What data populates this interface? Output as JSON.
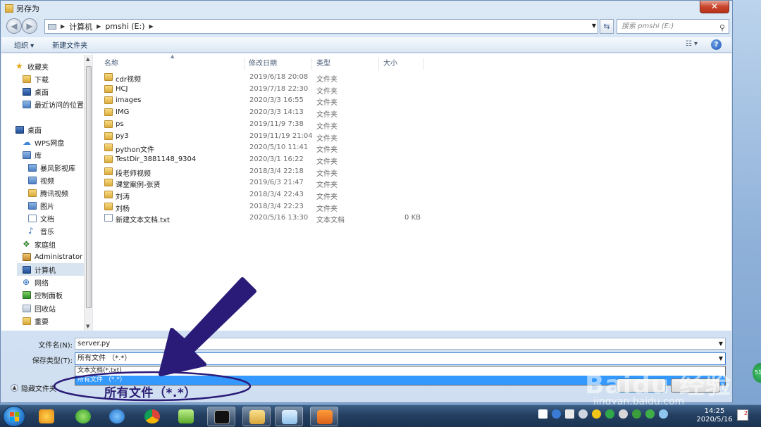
{
  "window": {
    "title": "另存为",
    "close_label": "✕"
  },
  "address": {
    "crumbs": [
      "计算机",
      "pmshi (E:)"
    ],
    "search_placeholder": "搜索 pmshi (E:)"
  },
  "toolbar": {
    "organize_label": "组织 ▾",
    "new_folder_label": "新建文件夹"
  },
  "sidebar": {
    "items": [
      {
        "label": "收藏夹",
        "icon": "star-icon"
      },
      {
        "label": "下载",
        "icon": "download-icon"
      },
      {
        "label": "桌面",
        "icon": "desktop-icon"
      },
      {
        "label": "最近访问的位置",
        "icon": "recent-icon"
      },
      {
        "label": "桌面",
        "icon": "desktop-icon"
      },
      {
        "label": "WPS网盘",
        "icon": "cloud-icon"
      },
      {
        "label": "库",
        "icon": "library-icon"
      },
      {
        "label": "暴风影视库",
        "icon": "video-library-icon"
      },
      {
        "label": "视频",
        "icon": "video-icon"
      },
      {
        "label": "腾讯视频",
        "icon": "folder-icon"
      },
      {
        "label": "图片",
        "icon": "picture-icon"
      },
      {
        "label": "文档",
        "icon": "document-icon"
      },
      {
        "label": "音乐",
        "icon": "music-icon"
      },
      {
        "label": "家庭组",
        "icon": "homegroup-icon"
      },
      {
        "label": "Administrator",
        "icon": "user-icon"
      },
      {
        "label": "计算机",
        "icon": "computer-icon"
      },
      {
        "label": "网络",
        "icon": "network-icon"
      },
      {
        "label": "控制面板",
        "icon": "control-panel-icon"
      },
      {
        "label": "回收站",
        "icon": "recycle-bin-icon"
      },
      {
        "label": "重要",
        "icon": "folder-icon"
      }
    ]
  },
  "columns": {
    "name": "名称",
    "date": "修改日期",
    "type": "类型",
    "size": "大小"
  },
  "files": [
    {
      "name": "cdr视频",
      "date": "2019/6/18 20:08",
      "type": "文件夹",
      "size": "",
      "kind": "folder"
    },
    {
      "name": "HCJ",
      "date": "2019/7/18 22:30",
      "type": "文件夹",
      "size": "",
      "kind": "folder"
    },
    {
      "name": "images",
      "date": "2020/3/3 16:55",
      "type": "文件夹",
      "size": "",
      "kind": "folder"
    },
    {
      "name": "IMG",
      "date": "2020/3/3 14:13",
      "type": "文件夹",
      "size": "",
      "kind": "folder"
    },
    {
      "name": "ps",
      "date": "2019/11/9 7:38",
      "type": "文件夹",
      "size": "",
      "kind": "folder"
    },
    {
      "name": "py3",
      "date": "2019/11/19 21:04",
      "type": "文件夹",
      "size": "",
      "kind": "folder"
    },
    {
      "name": "python文件",
      "date": "2020/5/10 11:41",
      "type": "文件夹",
      "size": "",
      "kind": "folder"
    },
    {
      "name": "TestDir_3881148_9304",
      "date": "2020/3/1 16:22",
      "type": "文件夹",
      "size": "",
      "kind": "folder"
    },
    {
      "name": "段老师视频",
      "date": "2018/3/4 22:18",
      "type": "文件夹",
      "size": "",
      "kind": "folder"
    },
    {
      "name": "课堂案例-张贤",
      "date": "2019/6/3 21:47",
      "type": "文件夹",
      "size": "",
      "kind": "folder"
    },
    {
      "name": "刘涛",
      "date": "2018/3/4 22:43",
      "type": "文件夹",
      "size": "",
      "kind": "folder"
    },
    {
      "name": "刘杨",
      "date": "2018/3/4 22:23",
      "type": "文件夹",
      "size": "",
      "kind": "folder"
    },
    {
      "name": "新建文本文档.txt",
      "date": "2020/5/16 13:30",
      "type": "文本文档",
      "size": "0 KB",
      "kind": "file"
    }
  ],
  "form": {
    "filename_label": "文件名(N):",
    "filename_value": "server.py",
    "filetype_label": "保存类型(T):",
    "filetype_value": "所有文件 （*.*）",
    "dropdown_options": [
      "文本文档(*.txt)",
      "所有文件 （*.*）"
    ],
    "hide_folders_label": "隐藏文件夹"
  },
  "annotation": {
    "text": "所有文件（*.*）",
    "color": "#2c1d74"
  },
  "watermark": {
    "main": "Baidu 经验",
    "sub": "jingyan.baidu.com"
  },
  "taskbar": {
    "time": "14:25",
    "date": "2020/5/16"
  }
}
